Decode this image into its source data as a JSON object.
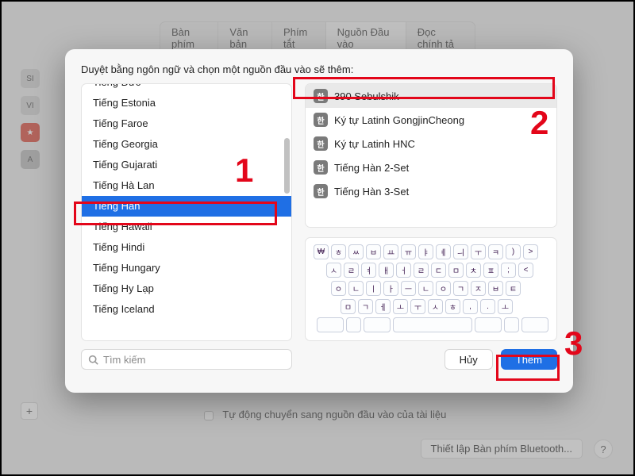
{
  "background": {
    "tabs": [
      "Bàn phím",
      "Văn bản",
      "Phím tắt",
      "Nguồn Đầu vào",
      "Đọc chính tả"
    ],
    "active_tab_index": 3,
    "bottom_checkbox_label": "Tự động chuyển sang nguồn đầu vào của tài liệu",
    "bluetooth_button": "Thiết lập Bàn phím Bluetooth...",
    "help_label": "?",
    "add_label": "+"
  },
  "modal": {
    "title": "Duyệt bằng ngôn ngữ và chọn một nguồn đầu vào sẽ thêm:",
    "languages": [
      "Tiếng Đức",
      "Tiếng Estonia",
      "Tiếng Faroe",
      "Tiếng Georgia",
      "Tiếng Gujarati",
      "Tiếng Hà Lan",
      "Tiếng Hàn",
      "Tiếng Hawaii",
      "Tiếng Hindi",
      "Tiếng Hungary",
      "Tiếng Hy Lạp",
      "Tiếng Iceland"
    ],
    "selected_language_index": 6,
    "layouts": [
      "390 Sebulshik",
      "Ký tự Latinh GongjinCheong",
      "Ký tự Latinh HNC",
      "Tiếng Hàn 2-Set",
      "Tiếng Hàn 3-Set"
    ],
    "selected_layout_index": 0,
    "layout_badge": "한",
    "keyboard_rows": {
      "r1": [
        "₩",
        "ㅎ",
        "ㅆ",
        "ㅂ",
        "ㅛ",
        "ㅠ",
        "ㅑ",
        "ㅖ",
        "ㅢ",
        "ㅜ",
        "ㅋ",
        ")",
        ">"
      ],
      "r2": [
        "ㅅ",
        "ㄹ",
        "ㅕ",
        "ㅐ",
        "ㅓ",
        "ㄹ",
        "ㄷ",
        "ㅁ",
        "ㅊ",
        "ㅍ",
        ";",
        "<"
      ],
      "r3": [
        "ㅇ",
        "ㄴ",
        "ㅣ",
        "ㅏ",
        "ㅡ",
        "ㄴ",
        "ㅇ",
        "ㄱ",
        "ㅈ",
        "ㅂ",
        "ㅌ"
      ],
      "r4": [
        "ㅁ",
        "ㄱ",
        "ㅔ",
        "ㅗ",
        "ㅜ",
        "ㅅ",
        "ㅎ",
        ",",
        ".",
        "ㅗ"
      ],
      "r5_parts": {
        "left1": "",
        "left2": "",
        "left3": "",
        "space": "",
        "right1": "",
        "right2": "",
        "right3": ""
      }
    },
    "search_placeholder": "Tìm kiếm",
    "cancel_label": "Hủy",
    "add_label": "Thêm"
  },
  "annotations": {
    "one": "1",
    "two": "2",
    "three": "3"
  }
}
